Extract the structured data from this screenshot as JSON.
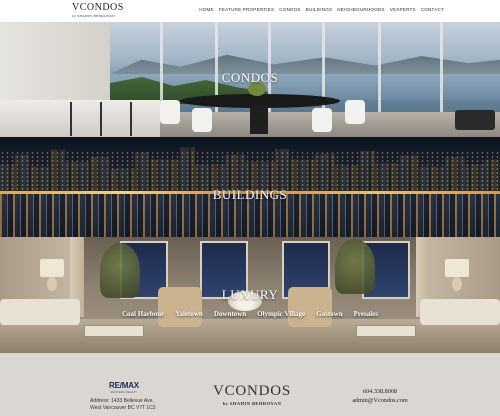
{
  "header": {
    "logo_main": "VCONDOS",
    "logo_sub": "by SHAHIN BEHROYAN",
    "nav": [
      "HOME",
      "FEATURE PROPERTIES",
      "CONDOS",
      "BUILDINGS",
      "NEIGHBOURHOODS",
      "VEXPERTS",
      "CONTACT"
    ]
  },
  "panels": {
    "condos": "CONDOS",
    "buildings": "BUILDINGS",
    "luxury": "LUXURY"
  },
  "neighbourhoods": [
    "Coal Harbour",
    "Yaletown",
    "Downtown",
    "Olympic Village",
    "Gastown",
    "Presales"
  ],
  "footer": {
    "remax_logo": "RE/MAX",
    "remax_sub": "MASTERS REALTY",
    "address_line1": "Address: 1433 Bellevue Ave,",
    "address_line2": "West Vancouver BC V7T 1C3",
    "logo_main": "VCONDOS",
    "logo_sub": "by SHAHIN BEHROYAN",
    "phone": "604.338.8068",
    "email": "admin@Vcondos.com"
  }
}
